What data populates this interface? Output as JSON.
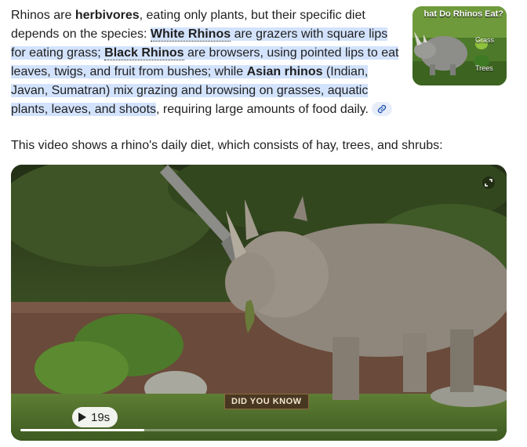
{
  "paragraph1": {
    "s1": "Rhinos are ",
    "s2": "herbivores",
    "s3": ", eating only plants, but their specific diet depends on the species: ",
    "s4": "White Rhinos",
    "s5": " are grazers with square lips for eating grass; ",
    "s6": "Black Rhinos",
    "s7": " are browsers, using pointed lips to eat leaves, twigs, and fruit from bushes; while ",
    "s8": "Asian rhinos",
    "s9": " (Indian, Javan, Sumatran) mix grazing and browsing on grasses, aquatic plants, leaves, and shoots",
    "s10": ", requiring large amounts of food daily."
  },
  "link_chip_icon": "link-icon",
  "thumbnail": {
    "title": "hat Do Rhinos Eat?",
    "label_grass": "Grass",
    "label_trees": "Trees"
  },
  "paragraph2": "This video shows a rhino's daily diet, which consists of hay, trees, and shrubs:",
  "video": {
    "caption": "DID YOU KNOW",
    "duration": "19s",
    "progress": 0.26,
    "fullscreen_icon": "fullscreen-icon",
    "play_icon": "play-icon"
  }
}
